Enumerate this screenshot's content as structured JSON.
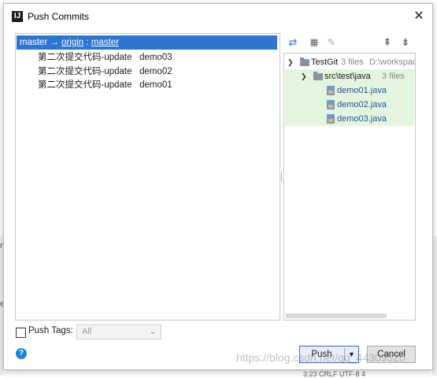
{
  "dialog": {
    "title": "Push Commits",
    "close_glyph": "✕"
  },
  "branch": {
    "local": "master",
    "arrow": " → ",
    "remote": "origin",
    "sep": " : ",
    "target": "master"
  },
  "commits": [
    "第二次提交代码-update   demo03",
    "第二次提交代码-update   demo02",
    "第二次提交代码-update   demo01"
  ],
  "tree": {
    "root": {
      "name": "TestGit",
      "count": "3 files",
      "path": "D:\\workspac"
    },
    "folder": {
      "name": "src\\test\\java",
      "count": "3 files"
    },
    "files": [
      "demo01.java",
      "demo02.java",
      "demo03.java"
    ]
  },
  "toolbar_icons": [
    "collapse-icon",
    "group-by-icon",
    "edit-icon",
    "expand-all-icon",
    "collapse-all-icon"
  ],
  "footer": {
    "push_tags_label": "Push Tags:",
    "tags_select_value": "All",
    "push_label": "Push",
    "cancel_label": "Cancel",
    "help_glyph": "?"
  },
  "background": {
    "frag_n": "n(",
    "frag_ex": "ex",
    "watermark": "https://blog.csdn.net/qq_44309520",
    "status": "3:23  CRLF  UTF-8  4"
  },
  "colors": {
    "selection": "#2e75d2",
    "changed_bg": "#e3f5dc",
    "file_link": "#2550a7",
    "primary_border": "#2a6bd1"
  }
}
